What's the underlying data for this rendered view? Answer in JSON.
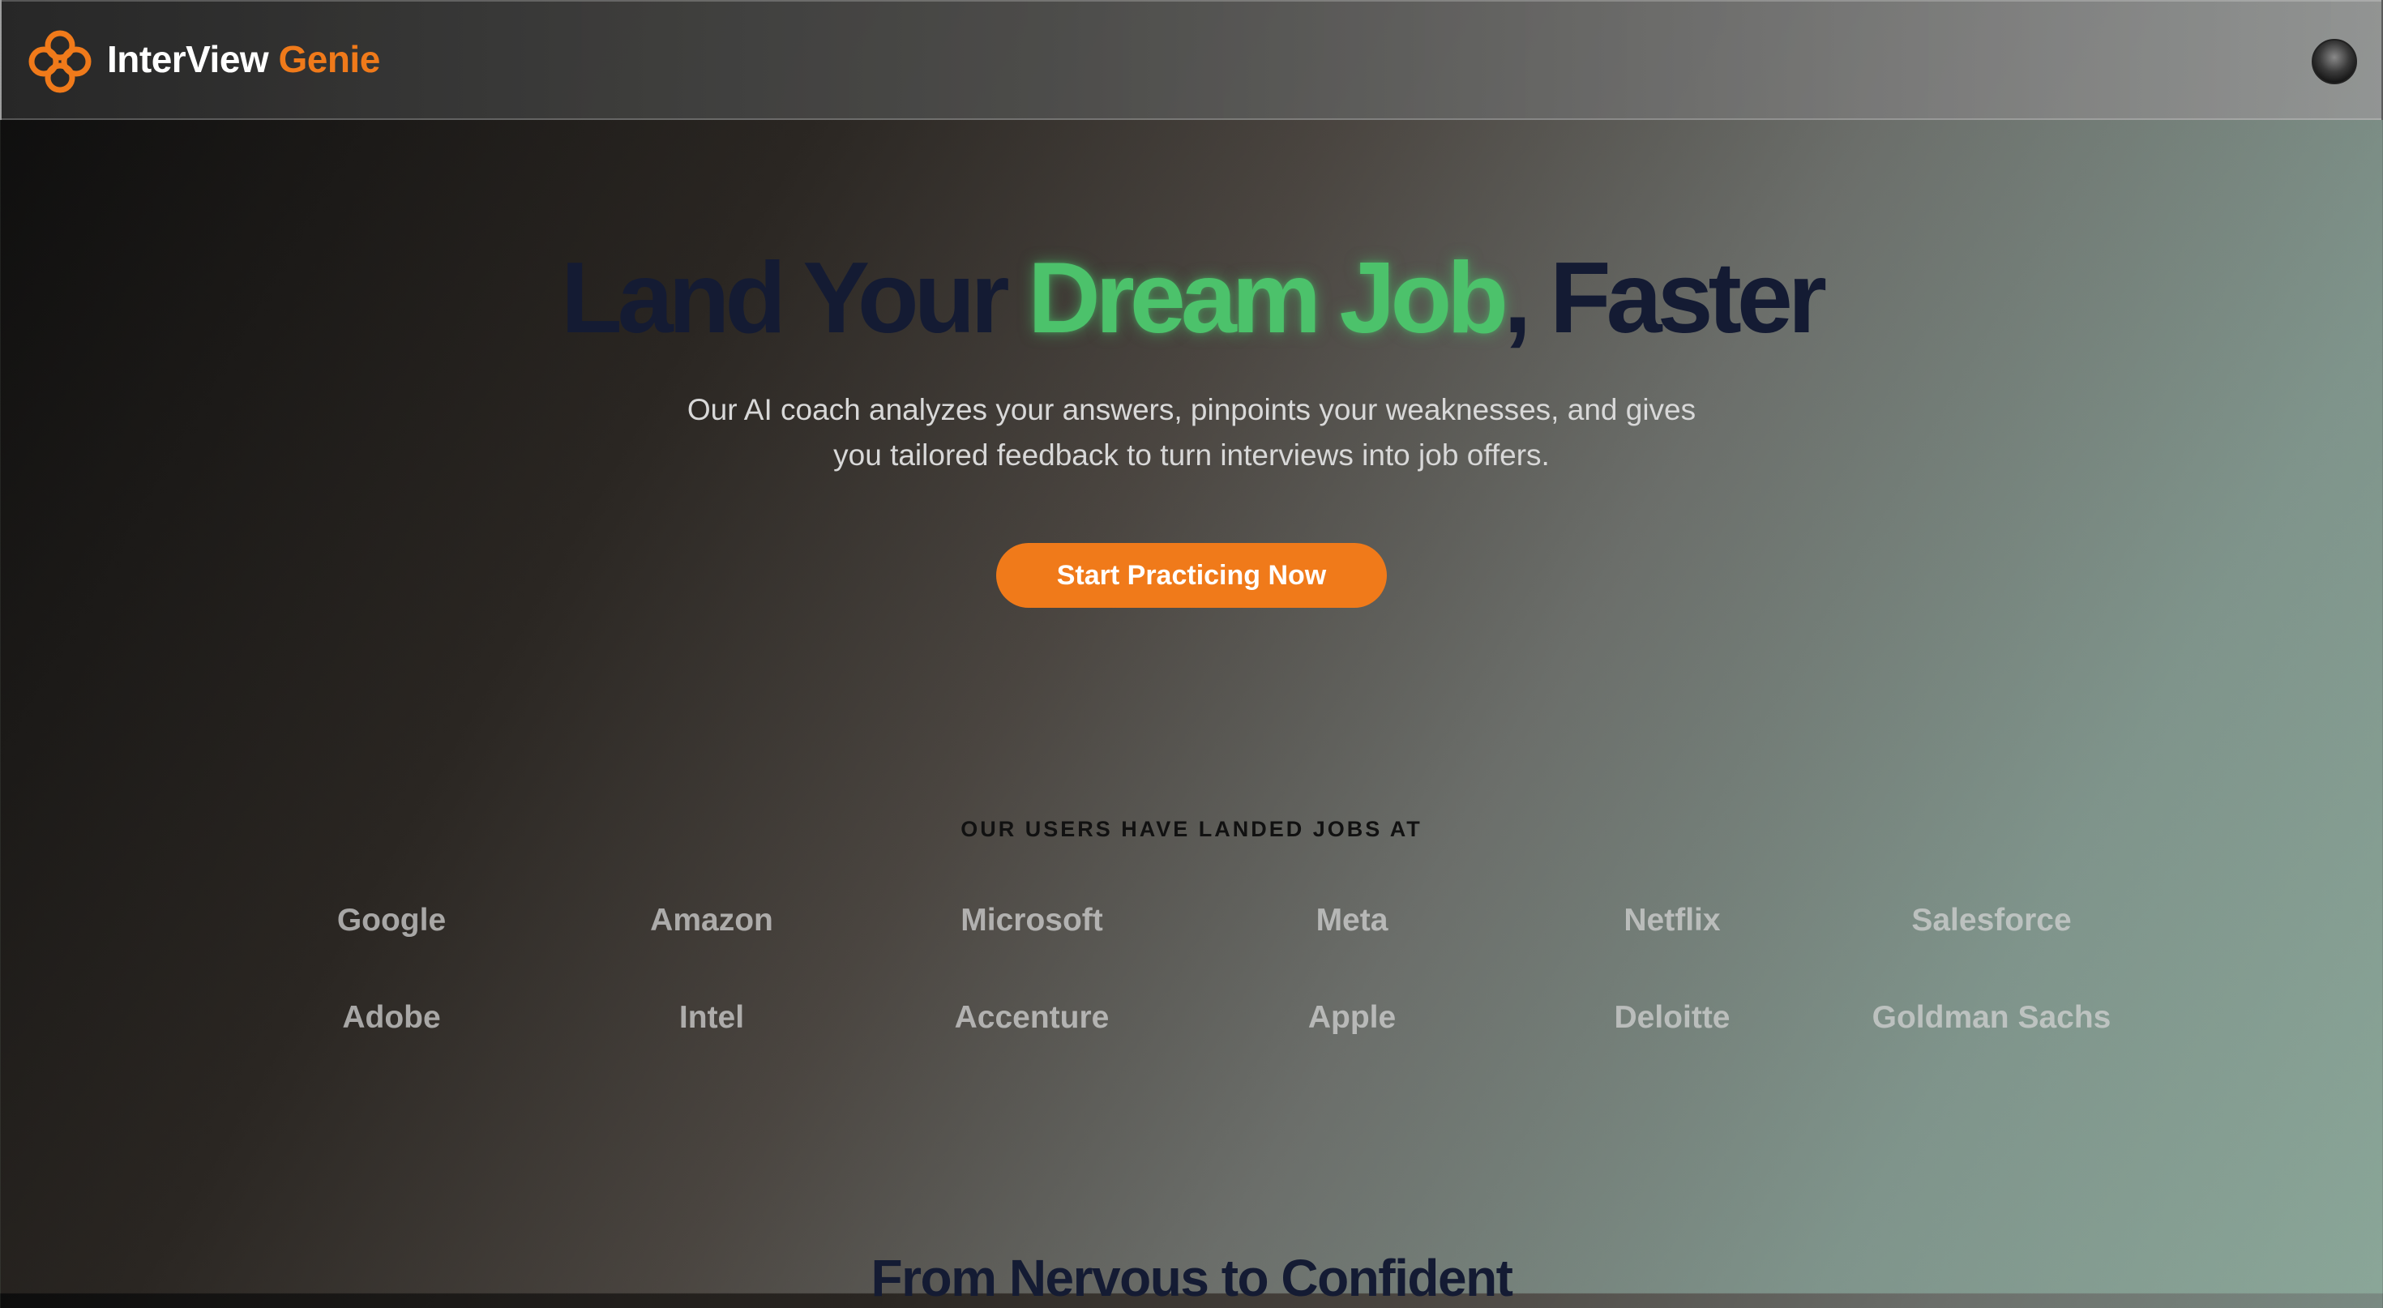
{
  "header": {
    "brand_main": "InterView",
    "brand_accent": "Genie",
    "logo_icon": "flower-knot-icon",
    "avatar_icon": "user-avatar-icon",
    "accent_color": "#f07a1a"
  },
  "hero": {
    "title_part1": "Land Your ",
    "title_highlight": "Dream Job",
    "title_part2": ", Faster",
    "highlight_color": "#4cc26b",
    "subtitle_line1": "Our AI coach analyzes your answers, pinpoints your weaknesses, and gives",
    "subtitle_line2": "you tailored feedback to turn interviews into job offers.",
    "cta_label": "Start Practicing Now"
  },
  "companies": {
    "heading": "OUR USERS HAVE LANDED JOBS AT",
    "row1": [
      "Google",
      "Amazon",
      "Microsoft",
      "Meta",
      "Netflix",
      "Salesforce"
    ],
    "row2": [
      "Adobe",
      "Intel",
      "Accenture",
      "Apple",
      "Deloitte",
      "Goldman Sachs"
    ]
  },
  "next_section": {
    "heading": "From Nervous to Confident"
  }
}
